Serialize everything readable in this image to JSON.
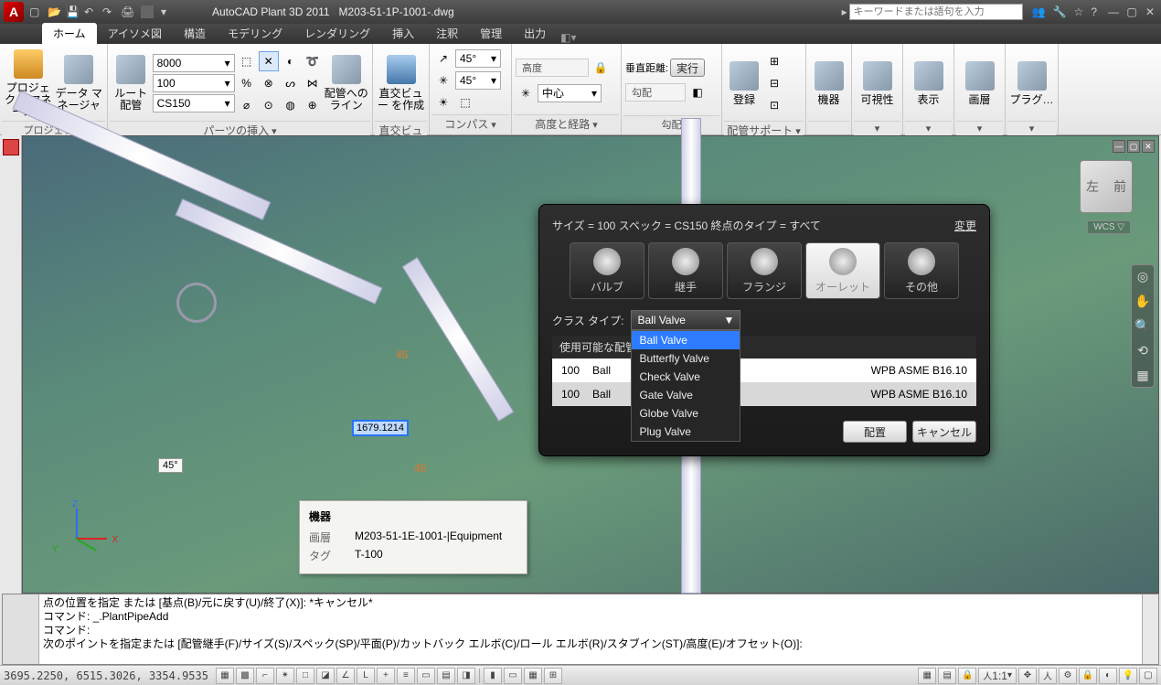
{
  "titlebar": {
    "app_initial": "A",
    "app_name": "AutoCAD Plant 3D 2011",
    "doc_name": "M203-51-1P-1001-.dwg",
    "search_placeholder": "キーワードまたは語句を入力"
  },
  "tabs": {
    "items": [
      "ホーム",
      "アイソメ図",
      "構造",
      "モデリング",
      "レンダリング",
      "挿入",
      "注釈",
      "管理",
      "出力"
    ],
    "active_index": 0
  },
  "ribbon": {
    "project": {
      "title": "プロジェクト",
      "btn1": "プロジェクト\nマネージャ",
      "btn2": "データ\nマネージャ"
    },
    "parts": {
      "title": "パーツの挿入",
      "route_btn": "ルート\n配管",
      "combo1": "8000",
      "combo2": "100",
      "combo3": "CS150",
      "lines_btn": "配管への\nライン"
    },
    "ortho": {
      "title": "直交ビュー",
      "btn": "直交ビュー\nを作成"
    },
    "compass": {
      "title": "コンパス",
      "v1": "45°",
      "v2": "45°"
    },
    "elev": {
      "title": "高度と経路",
      "lbl": "高度",
      "center": "中心"
    },
    "slope": {
      "title": "勾配",
      "lbl1": "垂直距離:",
      "btn": "実行",
      "lbl2": "勾配"
    },
    "support": {
      "title": "配管サポート",
      "btn": "登録"
    },
    "equip": {
      "title": "機器"
    },
    "vis": {
      "title": "可視性"
    },
    "disp": {
      "title": "表示"
    },
    "layer": {
      "title": "画層"
    },
    "plugin": {
      "title": "プラグ…"
    }
  },
  "drawing": {
    "wcs": "WCS ▽",
    "angle_text": "45°",
    "orange45a": "45",
    "orange45b": "45",
    "dim_value": "1679.1214"
  },
  "tooltip": {
    "title": "機器",
    "rows": [
      {
        "k": "画層",
        "v": "M203-51-1E-1001-|Equipment"
      },
      {
        "k": "タグ",
        "v": "T-100"
      }
    ]
  },
  "popup": {
    "header": "サイズ = 100  スペック = CS150  終点のタイプ =   すべて",
    "change": "変更",
    "categories": [
      "バルブ",
      "継手",
      "フランジ",
      "オーレット",
      "その他"
    ],
    "category_selected": 3,
    "class_label": "クラス タイプ:",
    "class_value": "Ball Valve",
    "class_options": [
      "Ball Valve",
      "Butterfly Valve",
      "Check Valve",
      "Gate Valve",
      "Globe Valve",
      "Plug Valve"
    ],
    "avail_label": "使用可能な配管",
    "specs": [
      {
        "size": "100",
        "name": "Ball",
        "tail": "WPB ASME B16.10"
      },
      {
        "size": "100",
        "name": "Ball",
        "tail": "WPB ASME B16.10"
      }
    ],
    "ok": "配置",
    "cancel": "キャンセル"
  },
  "cmd": {
    "line1": "点の位置を指定 または [基点(B)/元に戻す(U)/終了(X)]: *キャンセル*",
    "line2": "コマンド: _.PlantPipeAdd",
    "line3": "コマンド:",
    "line4": "次のポイントを指定または [配管継手(F)/サイズ(S)/スペック(SP)/平面(P)/カットバック エルボ(C)/ロール エルボ(R)/スタブイン(ST)/高度(E)/オフセット(O)]:"
  },
  "status": {
    "coords": "3695.2250, 6515.3026, 3354.9535",
    "scale": "1:1"
  }
}
